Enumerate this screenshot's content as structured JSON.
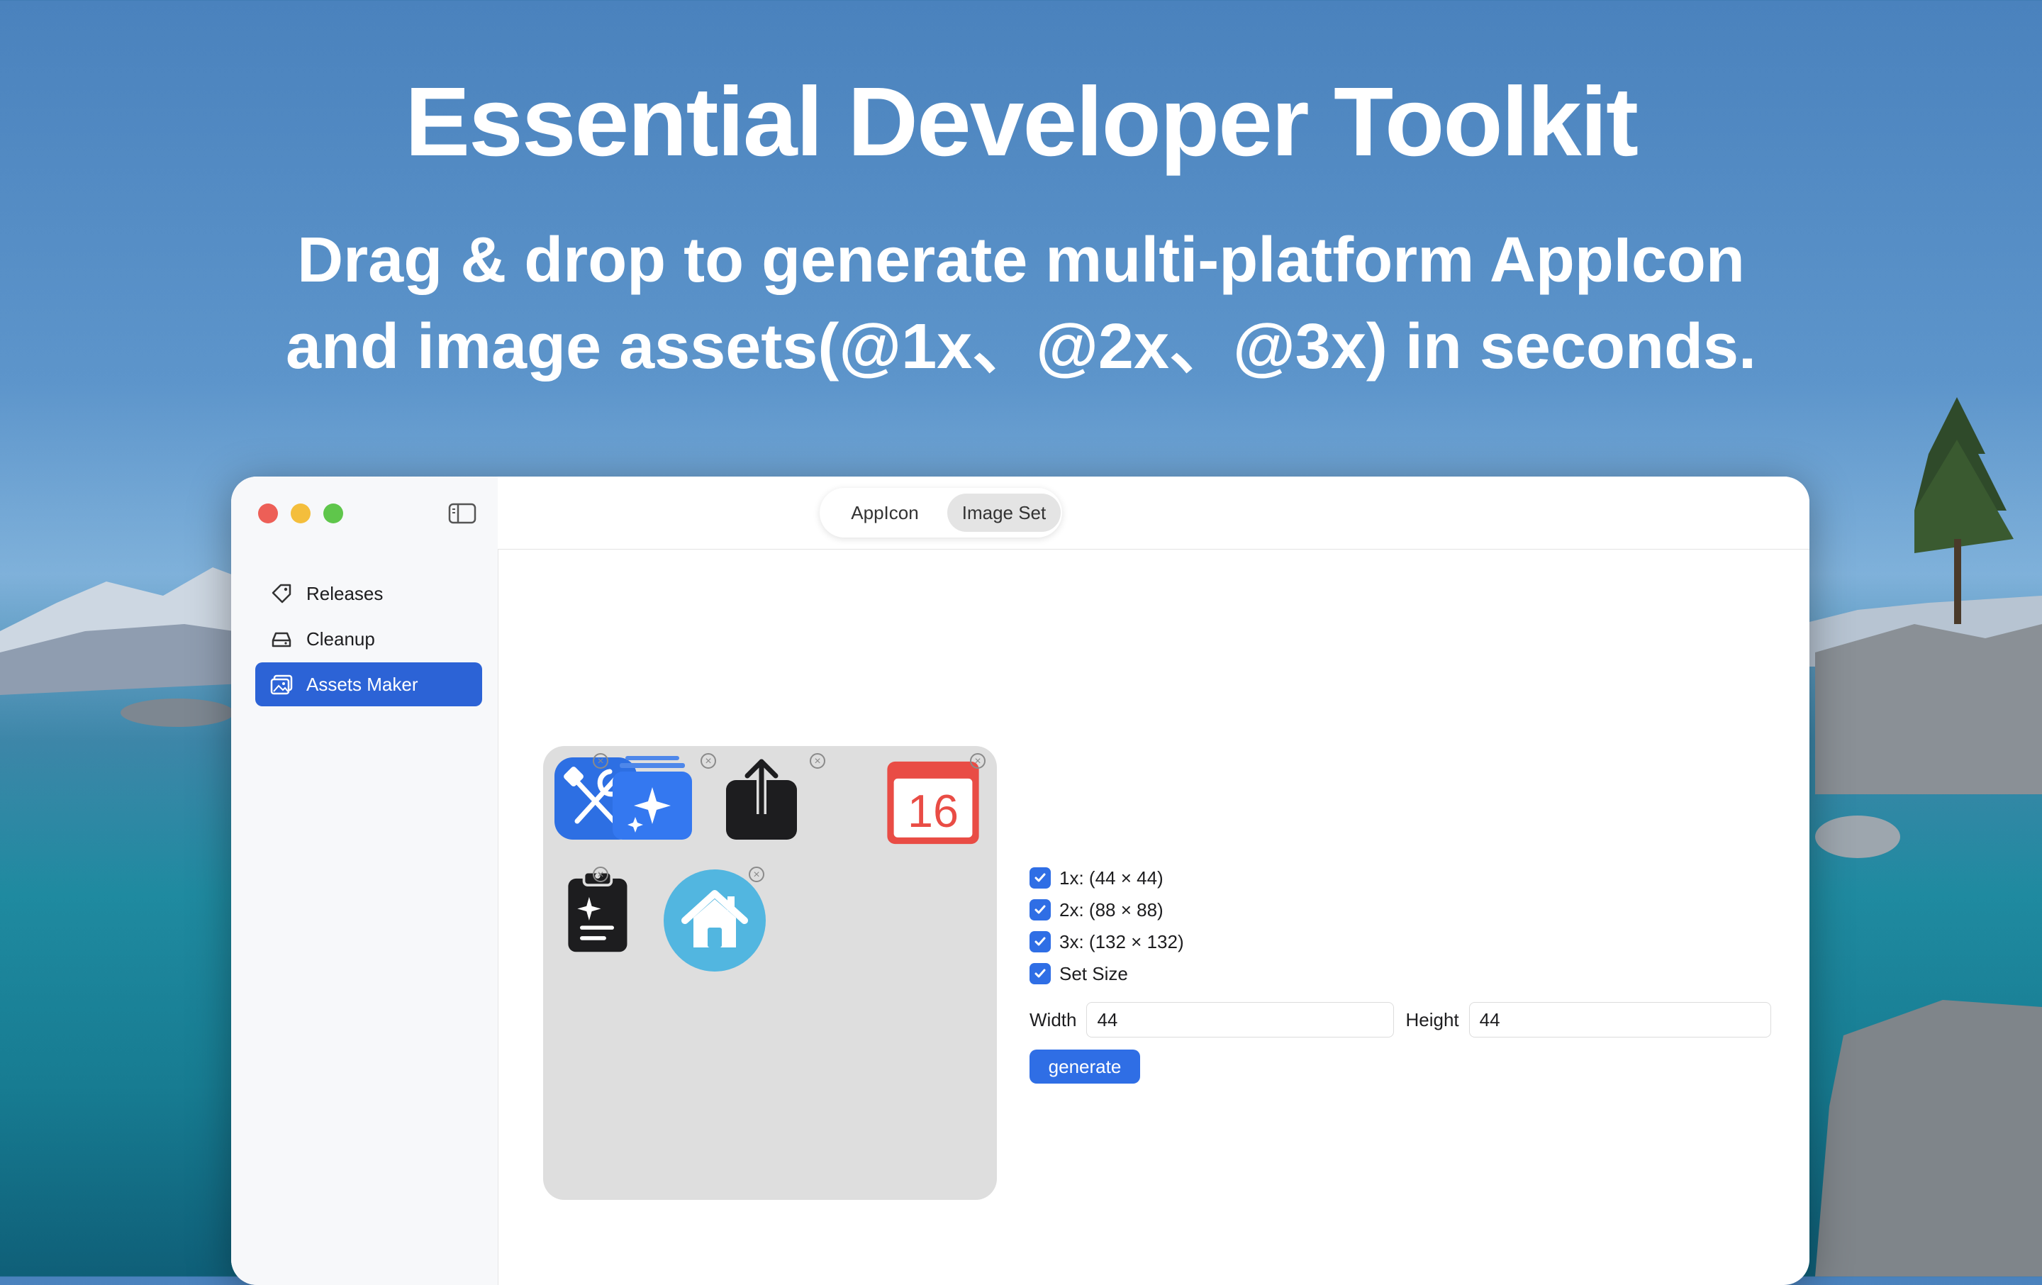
{
  "hero": {
    "title": "Essential Developer Toolkit",
    "subtitle_line1": "Drag & drop to generate multi-platform AppIcon",
    "subtitle_line2": "and image assets(@1x、@2x、@3x) in seconds."
  },
  "sidebar": {
    "items": [
      {
        "label": "Releases",
        "icon": "tag-icon",
        "active": false
      },
      {
        "label": "Cleanup",
        "icon": "drive-icon",
        "active": false
      },
      {
        "label": "Assets Maker",
        "icon": "photos-icon",
        "active": true
      }
    ]
  },
  "toolbar": {
    "tabs": [
      {
        "label": "AppIcon",
        "selected": false
      },
      {
        "label": "Image Set",
        "selected": true
      }
    ],
    "icons": [
      "dollar-icon",
      "gear-icon",
      "more-icon",
      "chevron-down-icon"
    ]
  },
  "assets": {
    "items": [
      {
        "name": "dev-tools-app-icon"
      },
      {
        "name": "sparkle-stack-icon"
      },
      {
        "name": "share-up-icon"
      },
      {
        "name": "calendar-icon",
        "text": "16"
      },
      {
        "name": "clipboard-sparkle-icon"
      },
      {
        "name": "home-circle-icon"
      }
    ],
    "remove_glyph": "×"
  },
  "options": {
    "scale_1x": "1x: (44 × 44)",
    "scale_2x": "2x: (88 × 88)",
    "scale_3x": "3x: (132 × 132)",
    "set_size": "Set Size",
    "width_label": "Width",
    "width_value": "44",
    "height_label": "Height",
    "height_value": "44",
    "generate_label": "generate"
  },
  "colors": {
    "accent": "#2f6ee5",
    "sidebar_active": "#2c63d6",
    "close": "#ed5f57",
    "minimize": "#f4be3c",
    "zoom": "#5fc64b"
  }
}
